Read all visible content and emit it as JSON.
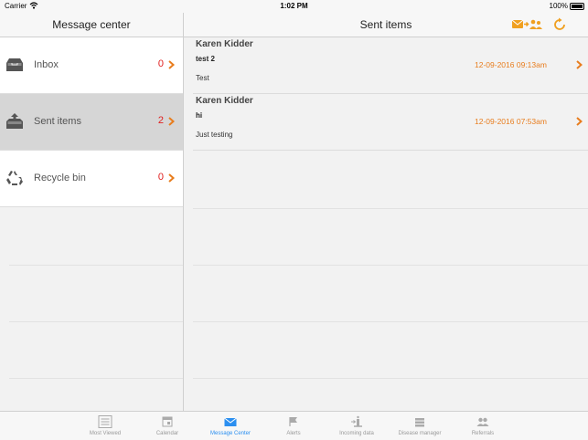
{
  "status_bar": {
    "carrier": "Carrier",
    "time": "1:02 PM",
    "battery": "100%"
  },
  "sidebar": {
    "title": "Message center",
    "folders": [
      {
        "label": "Inbox",
        "count": "0",
        "icon": "inbox-icon"
      },
      {
        "label": "Sent items",
        "count": "2",
        "icon": "outbox-icon"
      },
      {
        "label": "Recycle bin",
        "count": "0",
        "icon": "recycle-icon"
      }
    ]
  },
  "main": {
    "title": "Sent items",
    "messages": [
      {
        "sender": "Karen Kidder",
        "subject": "test 2",
        "preview": "Test",
        "date": "12-09-2016 09:13am"
      },
      {
        "sender": "Karen Kidder",
        "subject": "hi",
        "preview": "Just testing",
        "date": "12-09-2016 07:53am"
      }
    ]
  },
  "tabs": [
    {
      "label": "Most Viewed",
      "icon": "list-icon"
    },
    {
      "label": "Calendar",
      "icon": "calendar-icon"
    },
    {
      "label": "Message Center",
      "icon": "envelope-icon"
    },
    {
      "label": "Alerts",
      "icon": "flag-icon"
    },
    {
      "label": "Incoming data",
      "icon": "incoming-icon"
    },
    {
      "label": "Disease manager",
      "icon": "stack-icon"
    },
    {
      "label": "Referrals",
      "icon": "people-icon"
    }
  ],
  "colors": {
    "accent": "#e87d1e",
    "count": "#e02020",
    "tab_active": "#2b8ff0",
    "selected_row": "#d6d6d6"
  }
}
